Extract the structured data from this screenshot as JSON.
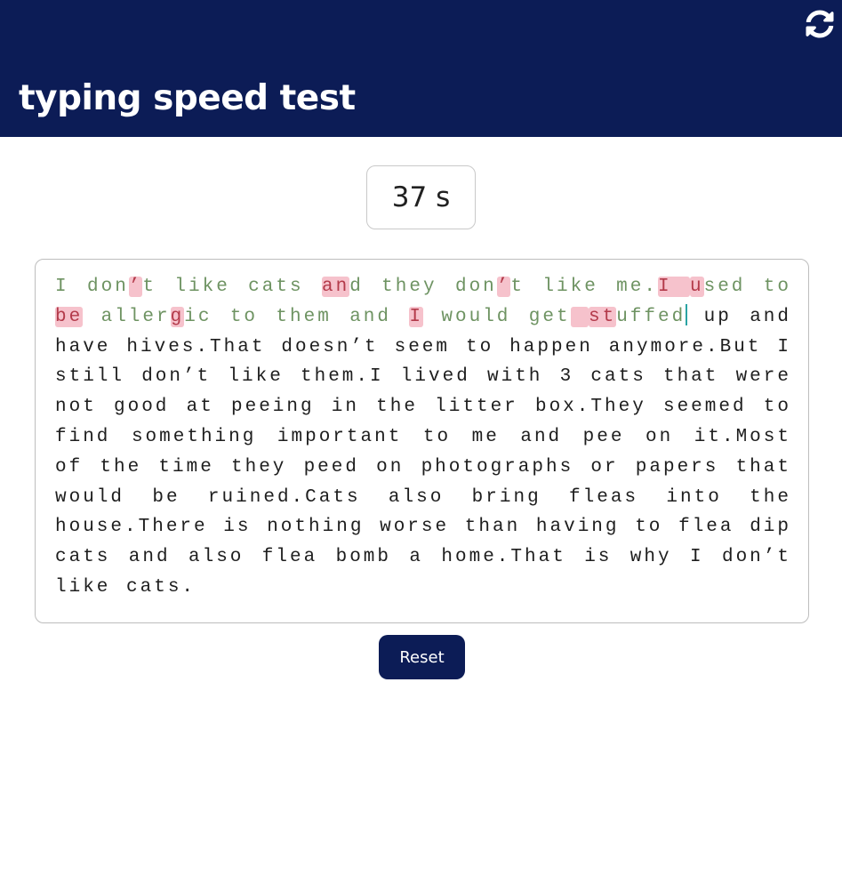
{
  "app": {
    "title": "typing speed test",
    "refresh_icon": "refresh-icon"
  },
  "timer": {
    "value": "37 s"
  },
  "passage": {
    "typed_segments": [
      {
        "t": "I don",
        "s": "ok"
      },
      {
        "t": "’",
        "s": "err"
      },
      {
        "t": "t like cats ",
        "s": "ok"
      },
      {
        "t": "an",
        "s": "err"
      },
      {
        "t": "d they don",
        "s": "ok"
      },
      {
        "t": "’",
        "s": "err"
      },
      {
        "t": "t like me.",
        "s": "ok"
      },
      {
        "t": "I ",
        "s": "err"
      },
      {
        "t": " ",
        "s": "err"
      },
      {
        "t": "u",
        "s": "err"
      },
      {
        "t": "sed to ",
        "s": "ok"
      },
      {
        "t": "be",
        "s": "err"
      },
      {
        "t": " aller",
        "s": "ok"
      },
      {
        "t": "g",
        "s": "err"
      },
      {
        "t": "ic to them and ",
        "s": "ok"
      },
      {
        "t": "I",
        "s": "err"
      },
      {
        "t": " would get",
        "s": "ok"
      },
      {
        "t": " ",
        "s": "err"
      },
      {
        "t": "st",
        "s": "err"
      },
      {
        "t": "uffed",
        "s": "ok"
      }
    ],
    "remaining_text": " up and have hives.That doesn’t seem to happen anymore.But I still don’t like them.I lived with 3 cats that were not good at peeing in the litter box.They seemed to find something important to me and pee on it.Most of the time they peed on photographs or papers that would be ruined.Cats also bring fleas into the house.There is nothing worse than having to flea dip cats and also flea bomb a home.That is why I don’t like cats."
  },
  "controls": {
    "reset_label": "Reset"
  },
  "colors": {
    "header_bg": "#0c1c56",
    "correct_text": "#6e9362",
    "error_text": "#b33a4a",
    "error_bg": "#f6c2cc",
    "cursor": "#2aa3a3"
  }
}
